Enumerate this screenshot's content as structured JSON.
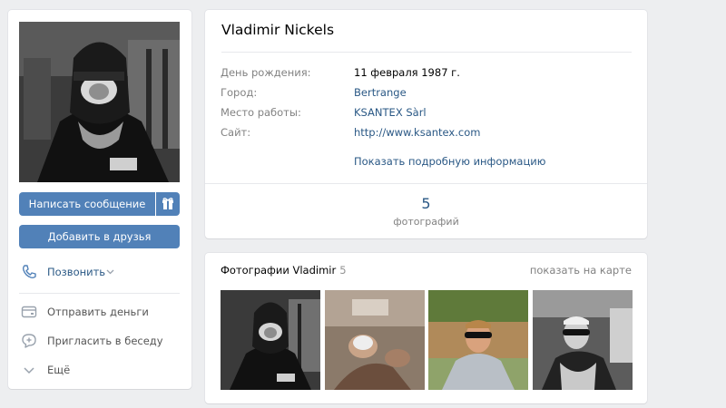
{
  "profile": {
    "name": "Vladimir Nickels",
    "fields": [
      {
        "label": "День рождения:",
        "value": "11 февраля 1987 г."
      },
      {
        "label": "Город:",
        "value": "Bertrange"
      },
      {
        "label": "Место работы:",
        "value": "KSANTEX Sàrl"
      },
      {
        "label": "Сайт:",
        "value": "http://www.ksantex.com"
      }
    ],
    "more_info": "Показать подробную информацию",
    "counter": {
      "value": "5",
      "label": "фотографий"
    }
  },
  "actions": {
    "message": "Написать сообщение",
    "add_friend": "Добавить в друзья"
  },
  "menu": {
    "call": "Позвонить",
    "send_money": "Отправить деньги",
    "invite": "Пригласить в беседу",
    "more": "Ещё"
  },
  "photos": {
    "title": "Фотографии Vladimir",
    "count": "5",
    "map_link": "показать на карте"
  },
  "colors": {
    "accent": "#5181b8",
    "link": "#2a5885",
    "background": "#edeef0"
  }
}
